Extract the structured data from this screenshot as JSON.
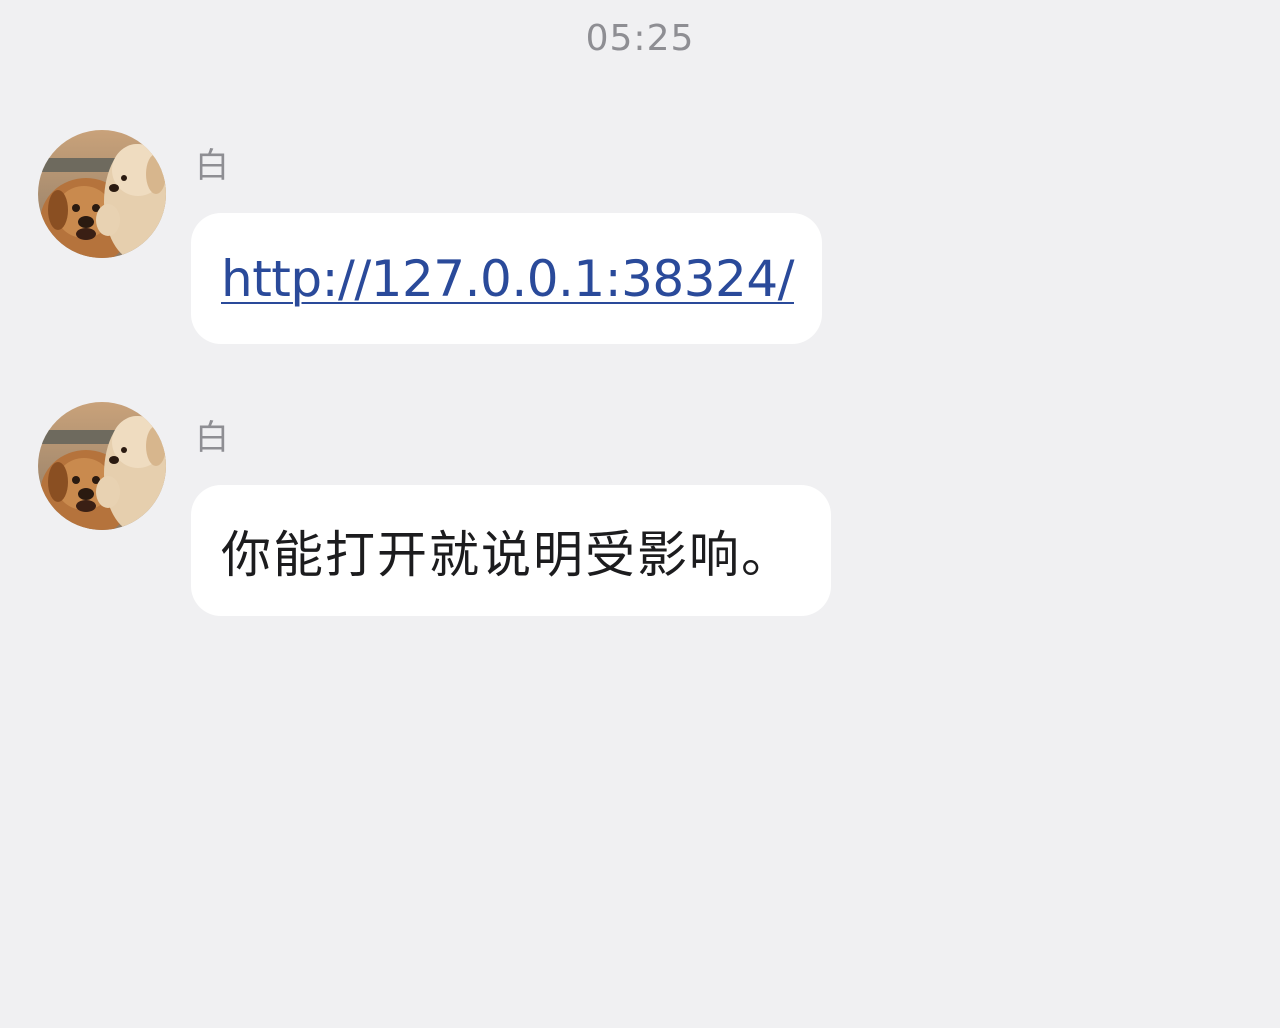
{
  "chat": {
    "timestamp": "05:25",
    "messages": [
      {
        "sender": "白",
        "avatar": "puppy-avatar",
        "type": "link",
        "text": "http://127.0.0.1:38324/"
      },
      {
        "sender": "白",
        "avatar": "puppy-avatar",
        "type": "text",
        "text": "你能打开就说明受影响。"
      }
    ]
  },
  "colors": {
    "background": "#f0f0f2",
    "bubble": "#ffffff",
    "link": "#2a4a9a",
    "meta_text": "#8e8e93",
    "message_text": "#1c1c1e"
  }
}
